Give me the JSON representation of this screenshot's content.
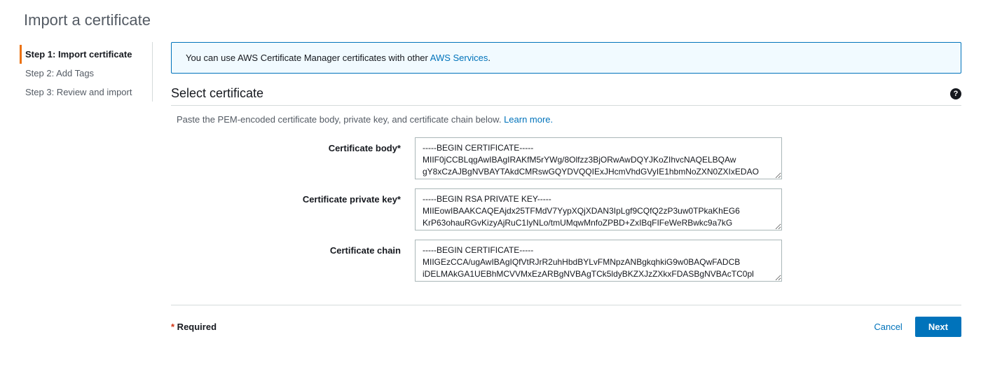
{
  "page": {
    "title": "Import a certificate"
  },
  "wizard": {
    "steps": [
      {
        "label": "Step 1: Import certificate",
        "active": true
      },
      {
        "label": "Step 2: Add Tags",
        "active": false
      },
      {
        "label": "Step 3: Review and import",
        "active": false
      }
    ]
  },
  "banner": {
    "text_prefix": "You can use AWS Certificate Manager certificates with other ",
    "link_text": "AWS Services",
    "suffix": "."
  },
  "section": {
    "heading": "Select certificate",
    "description_prefix": "Paste the PEM-encoded certificate body, private key, and certificate chain below. ",
    "learn_more": "Learn more."
  },
  "fields": {
    "cert_body": {
      "label": "Certificate body*",
      "value": "-----BEGIN CERTIFICATE-----\nMIIF0jCCBLqgAwIBAgIRAKfM5rYWg/8Olfzz3BjORwAwDQYJKoZIhvcNAQELBQAw\ngY8xCzAJBgNVBAYTAkdCMRswGQYDVQQIExJHcmVhdGVyIE1hbmNoZXN0ZXIxEDAO"
    },
    "cert_key": {
      "label": "Certificate private key*",
      "value": "-----BEGIN RSA PRIVATE KEY-----\nMIIEowIBAAKCAQEAjdx25TFMdV7YypXQjXDAN3IpLgf9CQfQ2zP3uw0TPkaKhEG6\nKrP63ohauRGvKizyAjRuC1IyNLo/tmUMqwMnfoZPBD+ZxIBqFIFeWeRBwkc9a7kG"
    },
    "cert_chain": {
      "label": "Certificate chain",
      "value": "-----BEGIN CERTIFICATE-----\nMIIGEzCCA/ugAwIBAgIQfVtRJrR2uhHbdBYLvFMNpzANBgkqhkiG9w0BAQwFADCB\niDELMAkGA1UEBhMCVVMxEzARBgNVBAgTCk5ldyBKZXJzZXkxFDASBgNVBAcTC0pl"
    }
  },
  "footer": {
    "required_asterisk": "*",
    "required_text": " Required",
    "cancel": "Cancel",
    "next": "Next"
  }
}
